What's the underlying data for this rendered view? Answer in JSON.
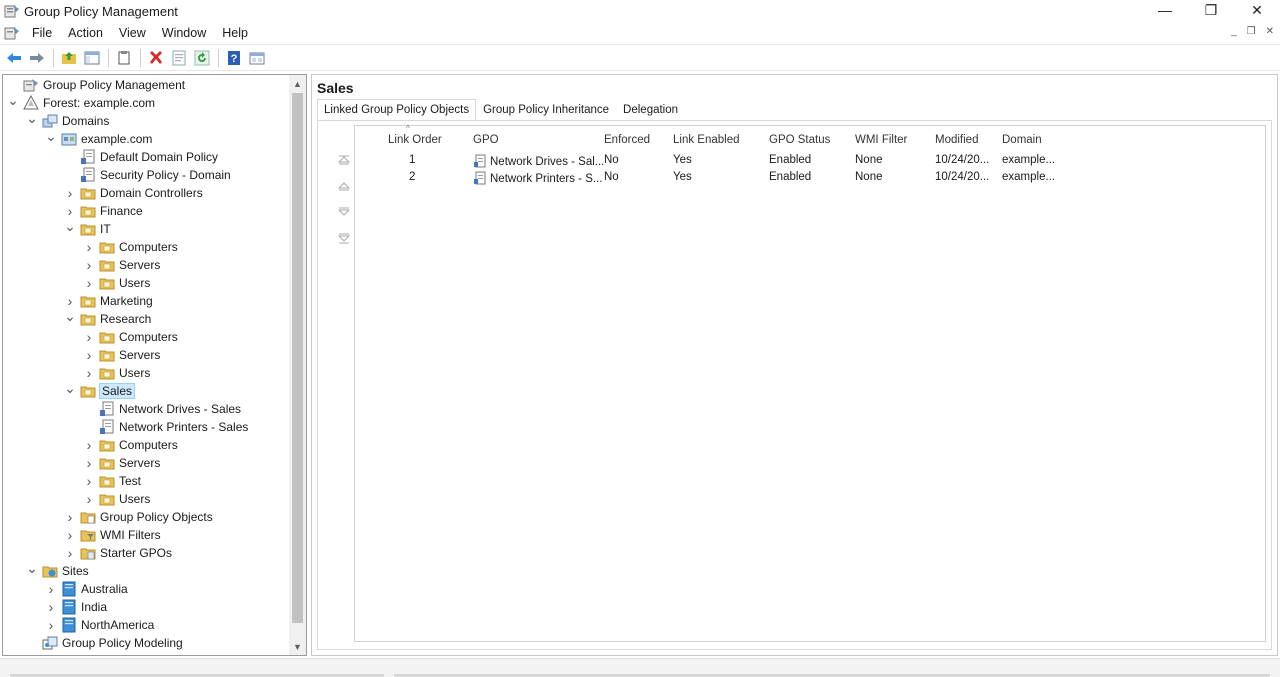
{
  "window": {
    "title": "Group Policy Management",
    "controls": {
      "minimize": "—",
      "restore": "❐",
      "close": "✕"
    },
    "mdi_controls": {
      "minimize": "_",
      "restore": "❐",
      "close": "✕"
    }
  },
  "menu": [
    "File",
    "Action",
    "View",
    "Window",
    "Help"
  ],
  "toolbar": {
    "buttons": [
      "back-arrow-icon",
      "forward-arrow-icon",
      "up-folder-icon",
      "show-hide-tree-icon",
      "copy-icon",
      "delete-icon",
      "properties-icon",
      "refresh-icon",
      "help-icon",
      "mmc-view-icon"
    ]
  },
  "tree": {
    "items": [
      {
        "label": "Group Policy Management",
        "icon": "gpm-console-icon",
        "level": 0,
        "chevron": "none"
      },
      {
        "label": "Forest: example.com",
        "icon": "forest-icon",
        "level": 0,
        "chevron": "expanded"
      },
      {
        "label": "Domains",
        "icon": "domains-icon",
        "level": 1,
        "chevron": "expanded"
      },
      {
        "label": "example.com",
        "icon": "domain-icon",
        "level": 2,
        "chevron": "expanded"
      },
      {
        "label": "Default Domain Policy",
        "icon": "gpo-link-icon",
        "level": 3,
        "chevron": "none"
      },
      {
        "label": "Security Policy - Domain",
        "icon": "gpo-link-icon",
        "level": 3,
        "chevron": "none"
      },
      {
        "label": "Domain Controllers",
        "icon": "ou-folder-icon",
        "level": 3,
        "chevron": "collapsed"
      },
      {
        "label": "Finance",
        "icon": "ou-folder-icon",
        "level": 3,
        "chevron": "collapsed"
      },
      {
        "label": "IT",
        "icon": "ou-folder-icon",
        "level": 3,
        "chevron": "expanded"
      },
      {
        "label": "Computers",
        "icon": "ou-folder-icon",
        "level": 4,
        "chevron": "collapsed"
      },
      {
        "label": "Servers",
        "icon": "ou-folder-icon",
        "level": 4,
        "chevron": "collapsed"
      },
      {
        "label": "Users",
        "icon": "ou-folder-icon",
        "level": 4,
        "chevron": "collapsed"
      },
      {
        "label": "Marketing",
        "icon": "ou-folder-icon",
        "level": 3,
        "chevron": "collapsed"
      },
      {
        "label": "Research",
        "icon": "ou-folder-icon",
        "level": 3,
        "chevron": "expanded"
      },
      {
        "label": "Computers",
        "icon": "ou-folder-icon",
        "level": 4,
        "chevron": "collapsed"
      },
      {
        "label": "Servers",
        "icon": "ou-folder-icon",
        "level": 4,
        "chevron": "collapsed"
      },
      {
        "label": "Users",
        "icon": "ou-folder-icon",
        "level": 4,
        "chevron": "collapsed"
      },
      {
        "label": "Sales",
        "icon": "ou-folder-icon",
        "level": 3,
        "chevron": "expanded",
        "selected": true
      },
      {
        "label": "Network Drives - Sales",
        "icon": "gpo-link-icon",
        "level": 4,
        "chevron": "none"
      },
      {
        "label": "Network Printers - Sales",
        "icon": "gpo-link-icon",
        "level": 4,
        "chevron": "none"
      },
      {
        "label": "Computers",
        "icon": "ou-folder-icon",
        "level": 4,
        "chevron": "collapsed"
      },
      {
        "label": "Servers",
        "icon": "ou-folder-icon",
        "level": 4,
        "chevron": "collapsed"
      },
      {
        "label": "Test",
        "icon": "ou-folder-icon",
        "level": 4,
        "chevron": "collapsed"
      },
      {
        "label": "Users",
        "icon": "ou-folder-icon",
        "level": 4,
        "chevron": "collapsed"
      },
      {
        "label": "Group Policy Objects",
        "icon": "gpo-container-icon",
        "level": 3,
        "chevron": "collapsed"
      },
      {
        "label": "WMI Filters",
        "icon": "wmi-filter-icon",
        "level": 3,
        "chevron": "collapsed"
      },
      {
        "label": "Starter GPOs",
        "icon": "starter-gpo-icon",
        "level": 3,
        "chevron": "collapsed"
      },
      {
        "label": "Sites",
        "icon": "sites-icon",
        "level": 1,
        "chevron": "expanded"
      },
      {
        "label": "Australia",
        "icon": "site-icon",
        "level": 2,
        "chevron": "collapsed"
      },
      {
        "label": "India",
        "icon": "site-icon",
        "level": 2,
        "chevron": "collapsed"
      },
      {
        "label": "NorthAmerica",
        "icon": "site-icon",
        "level": 2,
        "chevron": "collapsed"
      },
      {
        "label": "Group Policy Modeling",
        "icon": "modeling-icon",
        "level": 1,
        "chevron": "none"
      }
    ]
  },
  "details": {
    "title": "Sales",
    "tabs": [
      "Linked Group Policy Objects",
      "Group Policy Inheritance",
      "Delegation"
    ],
    "active_tab": 0,
    "columns": [
      "Link Order",
      "GPO",
      "Enforced",
      "Link Enabled",
      "GPO Status",
      "WMI Filter",
      "Modified",
      "Domain"
    ],
    "rows": [
      {
        "order": "1",
        "gpo": "Network Drives - Sal...",
        "enforced": "No",
        "link_enabled": "Yes",
        "status": "Enabled",
        "wmi": "None",
        "modified": "10/24/20...",
        "domain": "example..."
      },
      {
        "order": "2",
        "gpo": "Network Printers - S...",
        "enforced": "No",
        "link_enabled": "Yes",
        "status": "Enabled",
        "wmi": "None",
        "modified": "10/24/20...",
        "domain": "example..."
      }
    ],
    "order_buttons": [
      "move-to-top-icon",
      "move-up-icon",
      "move-down-icon",
      "move-to-bottom-icon"
    ]
  }
}
